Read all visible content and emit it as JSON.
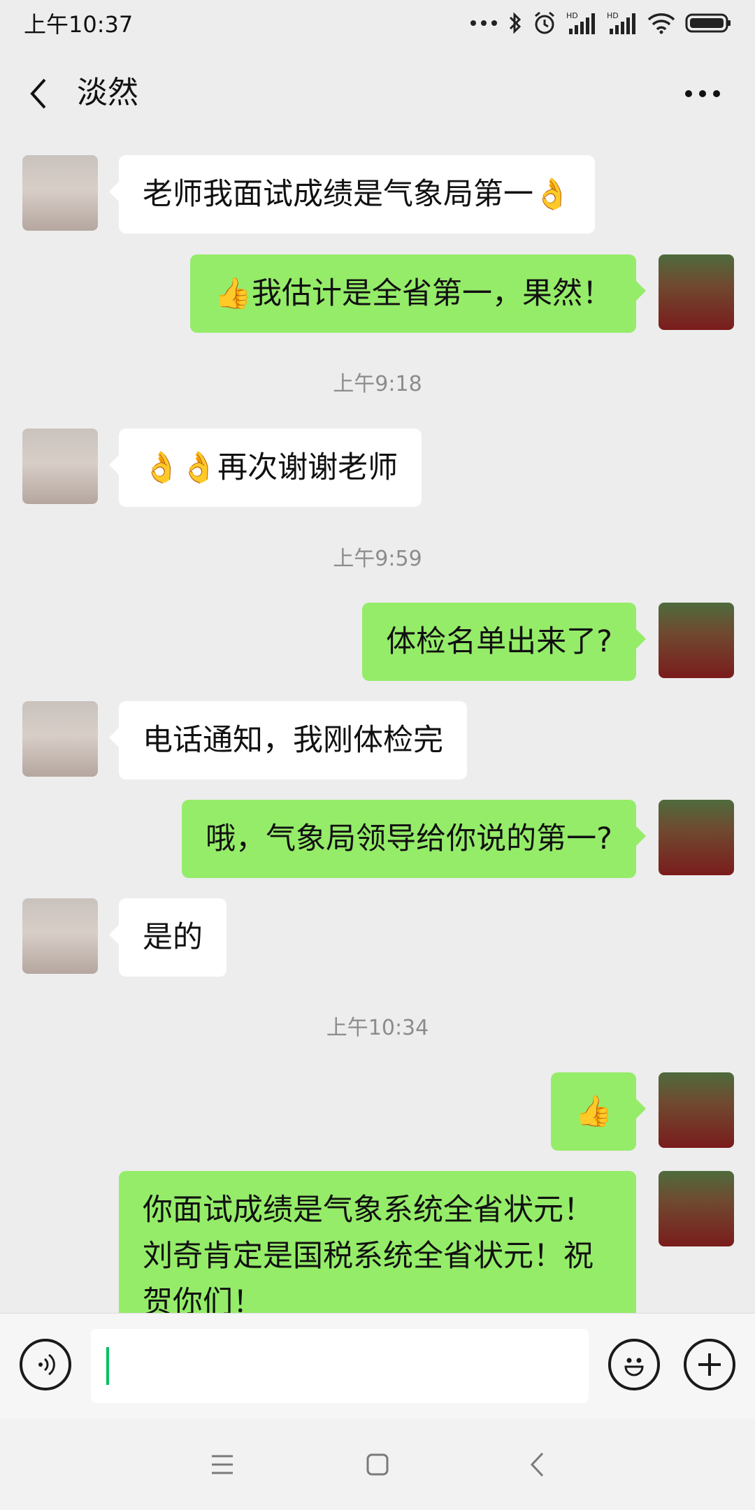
{
  "status_bar": {
    "time": "上午10:37",
    "icons": [
      "more-dots-icon",
      "bluetooth-icon",
      "alarm-icon",
      "hd-signal-icon",
      "hd-signal-icon",
      "wifi-icon",
      "battery-icon"
    ],
    "hd_label": "HD"
  },
  "header": {
    "title": "淡然",
    "back_icon": "chevron-left-icon",
    "more_icon": "more-dots-icon"
  },
  "messages": [
    {
      "side": "left",
      "text": "老师我面试成绩是气象局第一👌"
    },
    {
      "side": "right",
      "text": "👍我估计是全省第一，果然！"
    },
    {
      "type": "time",
      "text": "上午9:18"
    },
    {
      "side": "left",
      "text": "👌👌再次谢谢老师"
    },
    {
      "type": "time",
      "text": "上午9:59"
    },
    {
      "side": "right",
      "text": "体检名单出来了?"
    },
    {
      "side": "left",
      "text": "电话通知，我刚体检完"
    },
    {
      "side": "right",
      "text": "哦，气象局领导给你说的第一?"
    },
    {
      "side": "left",
      "text": "是的"
    },
    {
      "type": "time",
      "text": "上午10:34"
    },
    {
      "side": "right",
      "text": "👍"
    },
    {
      "side": "right",
      "text": "你面试成绩是气象系统全省状元！刘奇肯定是国税系统全省状元！祝贺你们！"
    }
  ],
  "input_bar": {
    "voice_icon": "voice-icon",
    "emoji_icon": "emoji-icon",
    "plus_icon": "plus-icon"
  },
  "nav_bar": {
    "icons": [
      "menu-icon",
      "home-icon",
      "back-icon"
    ]
  },
  "colors": {
    "background": "#ededed",
    "bubble_self": "#95ec69",
    "bubble_other": "#ffffff",
    "cursor": "#07c160"
  }
}
